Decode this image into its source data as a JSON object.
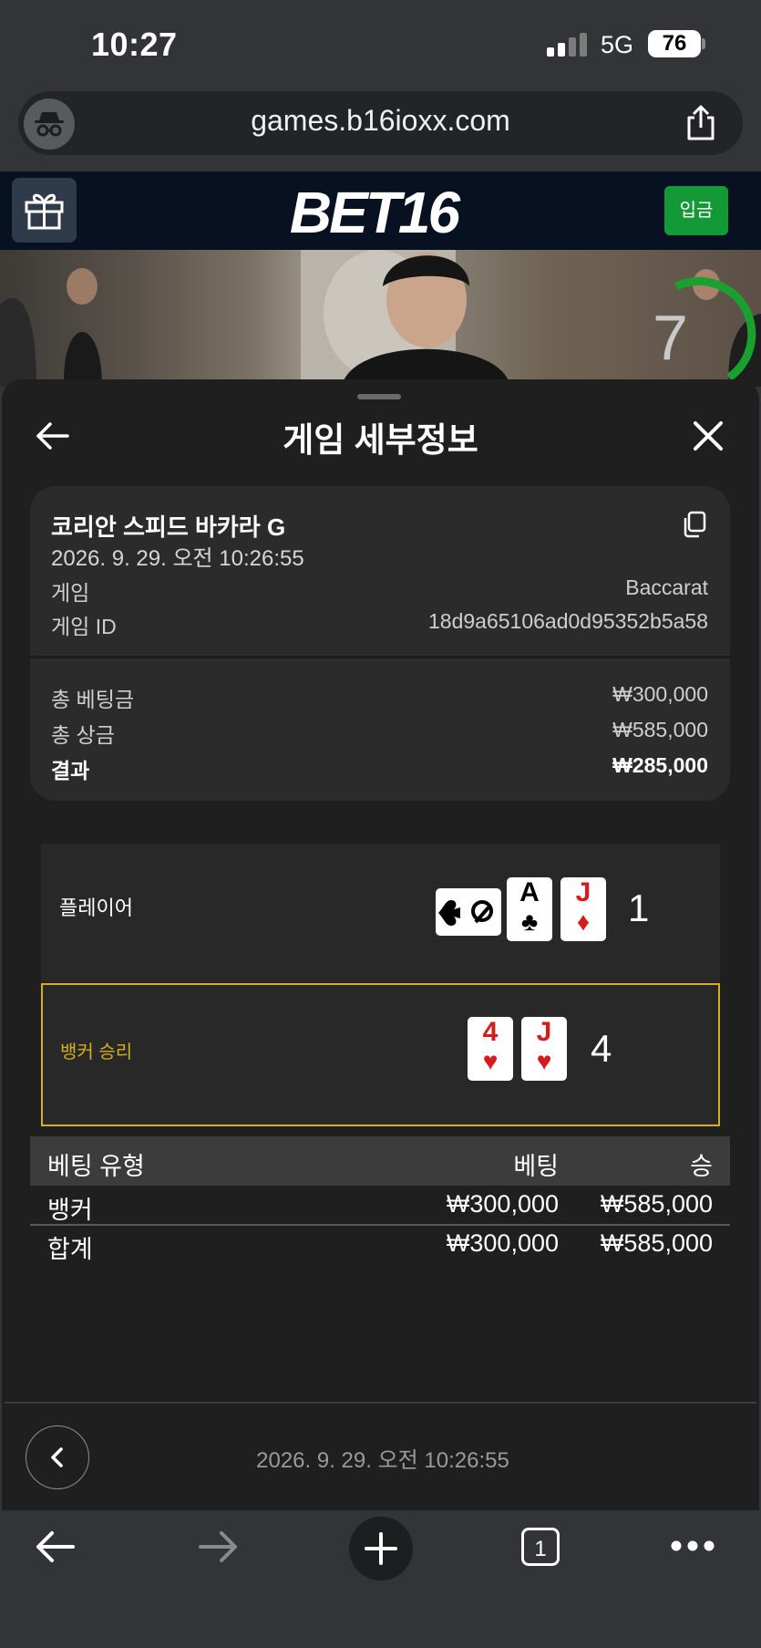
{
  "status_bar": {
    "time": "10:27",
    "network": "5G",
    "battery": "76"
  },
  "browser": {
    "url": "games.b16ioxx.com"
  },
  "site_header": {
    "logo": "BET16",
    "deposit_label": "입금"
  },
  "video": {
    "timer": "7"
  },
  "sheet": {
    "title": "게임 세부정보",
    "game_name": "코리안 스피드 바카라 G",
    "datetime": "2026. 9. 29. 오전 10:26:55",
    "rows": [
      {
        "label": "게임",
        "value": "Baccarat"
      },
      {
        "label": "게임 ID",
        "value": "18d9a65106ad0d95352b5a58"
      }
    ],
    "totals": [
      {
        "label": "총 베팅금",
        "value": "₩300,000"
      },
      {
        "label": "총 상금",
        "value": "₩585,000"
      },
      {
        "label": "결과",
        "value": "₩285,000"
      }
    ],
    "player": {
      "label": "플레이어",
      "score": "1",
      "cards": [
        {
          "rank": "A",
          "suit": "♣",
          "color": "#000000"
        },
        {
          "rank": "J",
          "suit": "♦",
          "color": "#d51c1c"
        }
      ]
    },
    "banker": {
      "label": "뱅커 승리",
      "score": "4",
      "cards": [
        {
          "rank": "4",
          "suit": "♥",
          "color": "#d51c1c"
        },
        {
          "rank": "J",
          "suit": "♥",
          "color": "#d51c1c"
        }
      ]
    },
    "bet_table": {
      "headers": [
        "베팅 유형",
        "베팅",
        "승"
      ],
      "rows": [
        [
          "뱅커",
          "₩300,000",
          "₩585,000"
        ],
        [
          "합계",
          "₩300,000",
          "₩585,000"
        ]
      ]
    },
    "footer_datetime": "2026. 9. 29. 오전 10:26:55"
  },
  "toolbar": {
    "tab_count": "1"
  },
  "colors": {
    "accent_gold": "#d4af1b",
    "deposit_green": "#139a36",
    "header_navy": "#071121"
  }
}
